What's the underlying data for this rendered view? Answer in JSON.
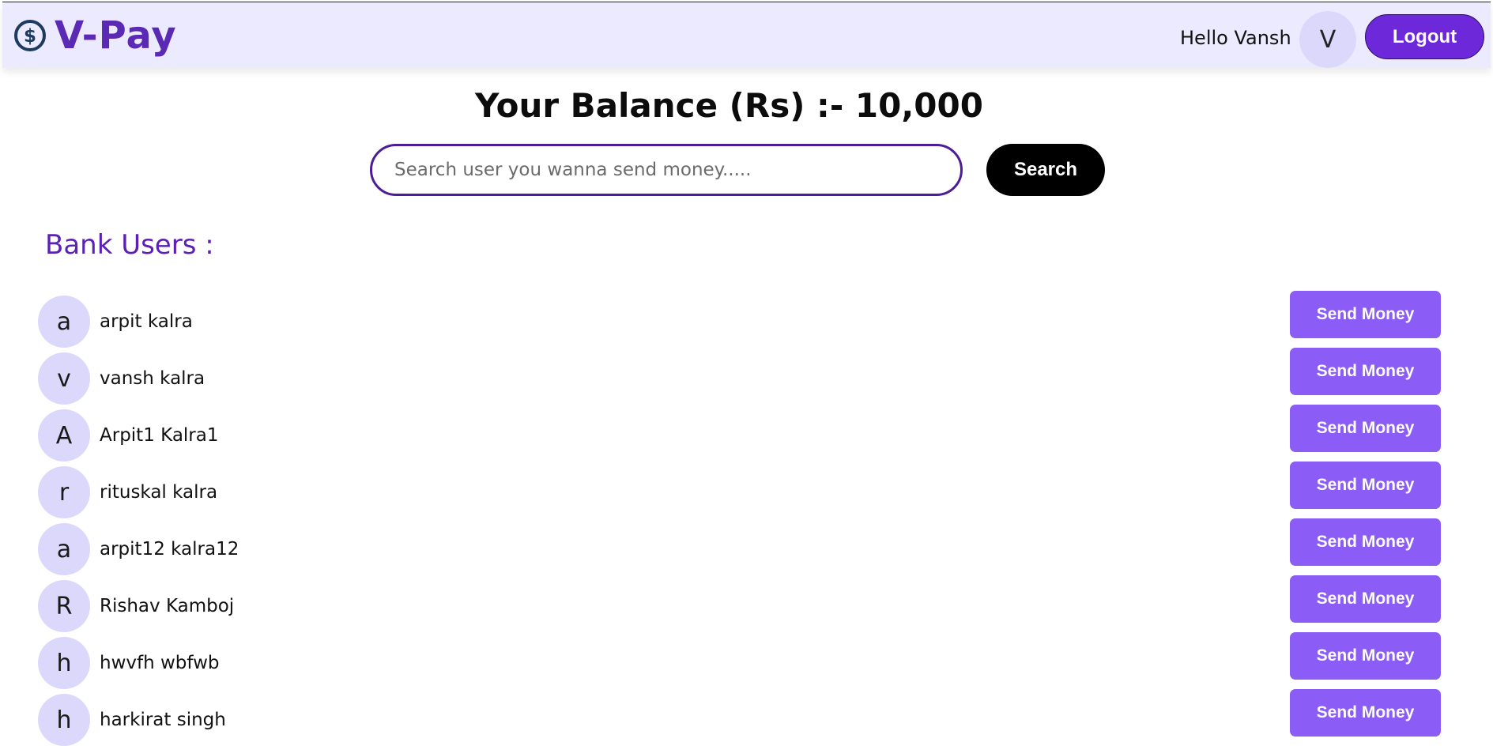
{
  "header": {
    "brand_name": "V-Pay",
    "brand_icon": "dollar-circle-icon",
    "greeting": "Hello Vansh",
    "avatar_initial": "V",
    "logout_label": "Logout",
    "colors": {
      "bar_background": "#eceafe",
      "brand": "#5b2ab5",
      "logout_button": "#6d28d9",
      "icon": "#1e3a5f"
    }
  },
  "balance": {
    "text": "Your Balance (Rs) :- 10,000"
  },
  "search": {
    "placeholder": "Search user you wanna send money.....",
    "value": "",
    "button_label": "Search"
  },
  "users_section": {
    "heading": "Bank Users :",
    "send_button_label": "Send Money",
    "send_button_color": "#8b5cf6",
    "users": [
      {
        "initial": "a",
        "name": "arpit kalra"
      },
      {
        "initial": "v",
        "name": "vansh kalra"
      },
      {
        "initial": "A",
        "name": "Arpit1 Kalra1"
      },
      {
        "initial": "r",
        "name": "rituskal kalra"
      },
      {
        "initial": "a",
        "name": "arpit12 kalra12"
      },
      {
        "initial": "R",
        "name": "Rishav Kamboj"
      },
      {
        "initial": "h",
        "name": "hwvfh wbfwb"
      },
      {
        "initial": "h",
        "name": "harkirat singh"
      }
    ]
  }
}
